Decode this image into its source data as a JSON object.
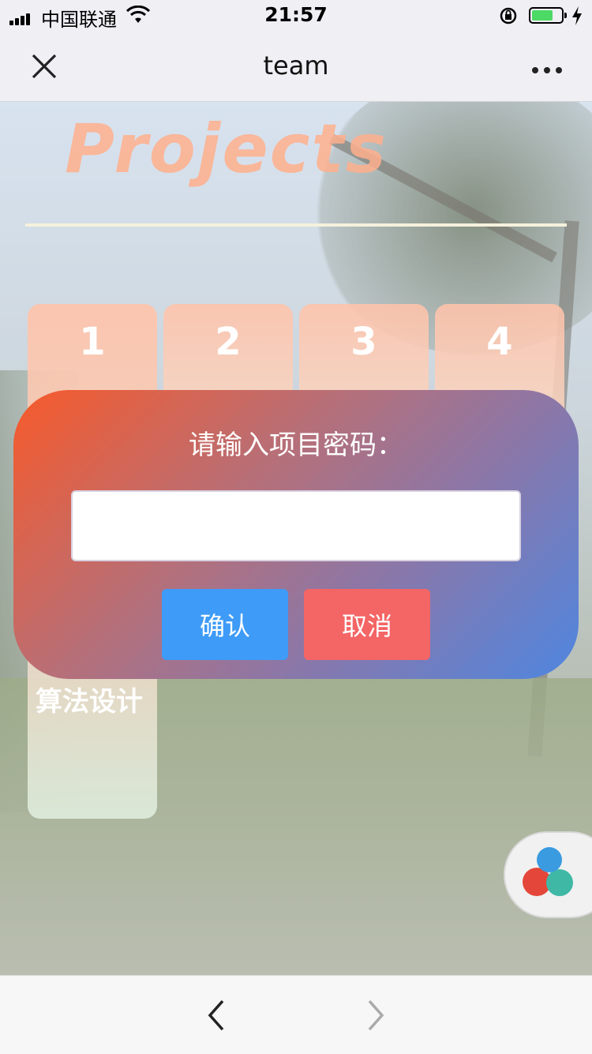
{
  "status_bar": {
    "carrier": "中国联通",
    "time": "21:57",
    "battery_level": 0.6
  },
  "nav": {
    "title": "team",
    "close_icon": "close-icon",
    "more_icon": "more-icon"
  },
  "page": {
    "heading": "Projects",
    "cards": [
      {
        "label": "1",
        "subtitle": "算法设计"
      },
      {
        "label": "2"
      },
      {
        "label": "3"
      },
      {
        "label": "4"
      }
    ]
  },
  "dialog": {
    "prompt": "请输入项目密码：",
    "password_value": "",
    "confirm_label": "确认",
    "cancel_label": "取消"
  },
  "colors": {
    "confirm": "#3e9bf7",
    "cancel": "#f46565",
    "heading": "#ffaf8c"
  },
  "toolbar": {
    "back_icon": "chevron-left-icon",
    "forward_icon": "chevron-right-icon"
  }
}
